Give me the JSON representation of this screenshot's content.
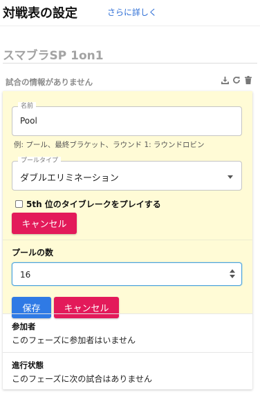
{
  "header": {
    "title": "対戦表の設定",
    "learn_more": "さらに詳しく"
  },
  "event": {
    "name": "スマブラSP 1on1",
    "no_match_info": "試合の情報がありません",
    "tool_icons": [
      "download-icon",
      "refresh-icon",
      "trash-icon"
    ]
  },
  "pool_form": {
    "name_label": "名前",
    "name_value": "Pool",
    "name_helper": "例: プール、最終ブラケット、ラウンド 1: ラウンドロビン",
    "pool_type_label": "プールタイプ",
    "pool_type_value": "ダブルエリミネーション",
    "tiebreak_label": "5th 位のタイブレークをプレイする",
    "tiebreak_checked": false,
    "cancel_label": "キャンセル"
  },
  "pool_count": {
    "label": "プールの数",
    "value": "16",
    "save_label": "保存",
    "cancel_label": "キャンセル"
  },
  "participants": {
    "title": "参加者",
    "text": "このフェーズに参加者はいません"
  },
  "progress": {
    "title": "進行状態",
    "text": "このフェーズに次の試合はありません"
  },
  "colors": {
    "accent_blue": "#2f7ae5",
    "cancel_pink": "#e31a5a",
    "section_yellow": "#fffbd6",
    "link_blue": "#2f6fd6"
  }
}
